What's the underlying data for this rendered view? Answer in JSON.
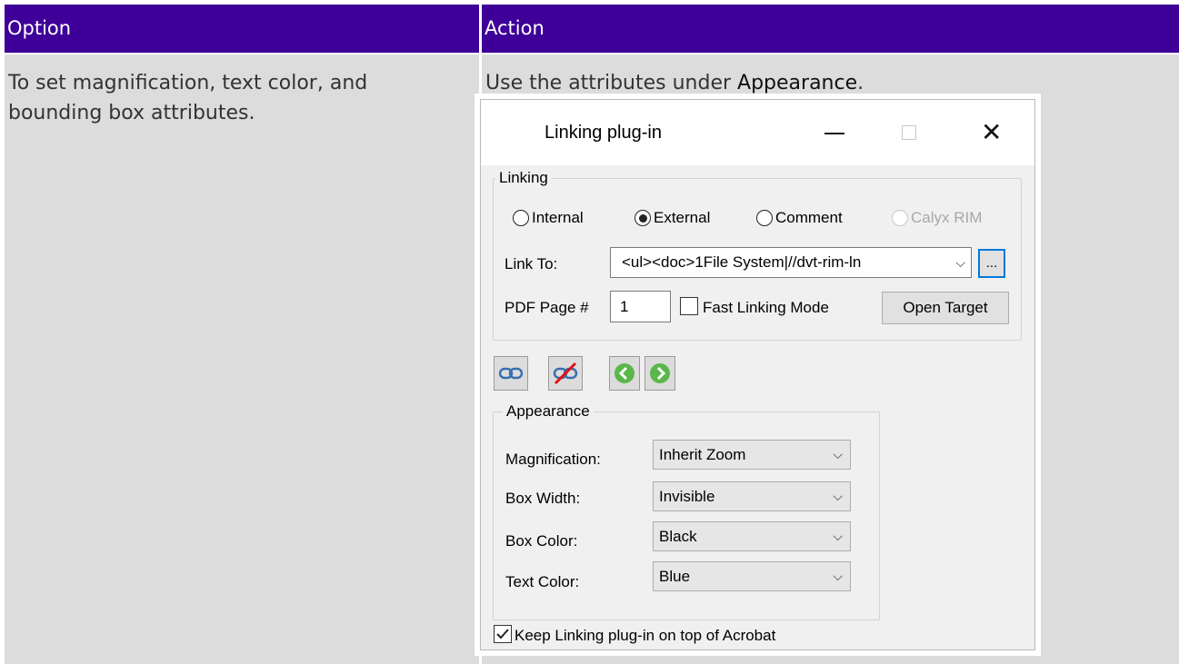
{
  "table": {
    "headers": {
      "option": "Option",
      "action": "Action"
    },
    "row": {
      "option_text": "To set magnification, text color, and bounding box attributes.",
      "action_prefix": "Use the attributes under ",
      "action_term": "Appearance",
      "action_suffix": "."
    }
  },
  "dialog": {
    "title": "Linking plug-in",
    "linking": {
      "legend": "Linking",
      "radios": [
        {
          "label": "Internal",
          "checked": false,
          "disabled": false
        },
        {
          "label": "External",
          "checked": true,
          "disabled": false
        },
        {
          "label": "Comment",
          "checked": false,
          "disabled": false
        },
        {
          "label": "Calyx RIM",
          "checked": false,
          "disabled": true
        }
      ],
      "link_to_label": "Link To:",
      "link_to_value": "<ul><doc>1File System|//dvt-rim-ln",
      "browse_label": "...",
      "pdf_page_label": "PDF Page #",
      "pdf_page_value": "1",
      "fast_linking_label": "Fast Linking Mode",
      "fast_linking_checked": false,
      "open_target_label": "Open Target"
    },
    "toolbar": {
      "icons": [
        "create-link-icon",
        "delete-link-icon",
        "previous-icon",
        "next-icon"
      ]
    },
    "appearance": {
      "legend": "Appearance",
      "rows": [
        {
          "label": "Magnification:",
          "value": "Inherit Zoom"
        },
        {
          "label": "Box Width:",
          "value": "Invisible"
        },
        {
          "label": "Box Color:",
          "value": "Black"
        },
        {
          "label": "Text Color:",
          "value": "Blue"
        }
      ]
    },
    "keep_on_top_label": "Keep Linking plug-in on top of Acrobat",
    "keep_on_top_checked": true
  },
  "colors": {
    "header_bg": "#3e0098",
    "cell_bg": "#dcdcdc",
    "focus_blue": "#0078d7",
    "arrow_green": "#5ab74a"
  }
}
